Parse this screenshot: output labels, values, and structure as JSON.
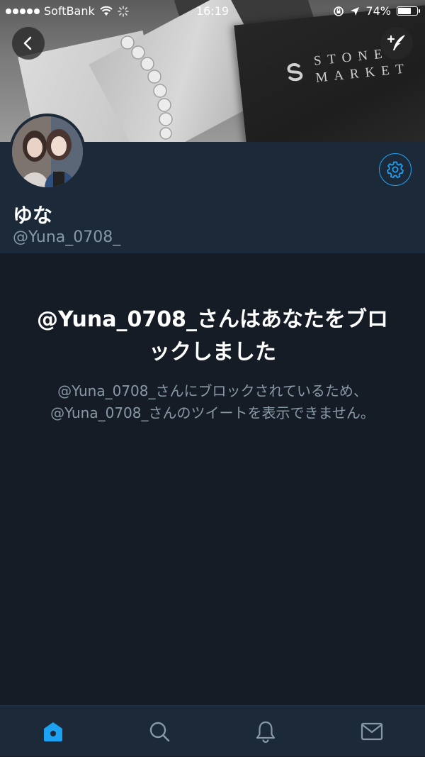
{
  "status_bar": {
    "carrier": "SoftBank",
    "time": "16:19",
    "battery_percent": "74%",
    "battery_level": 0.74,
    "signal_bars": 5
  },
  "banner": {
    "brand_line1": "STONE",
    "brand_line2": "MARKET"
  },
  "profile": {
    "display_name": "ゆな",
    "handle": "@Yuna_0708_"
  },
  "blocked": {
    "title": "@Yuna_0708_さんはあなたをブロックしました",
    "description": "@Yuna_0708_さんにブロックされているため、@Yuna_0708_さんのツイートを表示できません。"
  },
  "tabs": [
    {
      "name": "home",
      "icon": "home-icon",
      "active": true
    },
    {
      "name": "search",
      "icon": "search-icon",
      "active": false
    },
    {
      "name": "notifications",
      "icon": "bell-icon",
      "active": false
    },
    {
      "name": "messages",
      "icon": "mail-icon",
      "active": false
    }
  ],
  "colors": {
    "accent": "#1da1f2",
    "background": "#151c26",
    "panel": "#1c2938",
    "secondary_text": "#8899a6"
  }
}
